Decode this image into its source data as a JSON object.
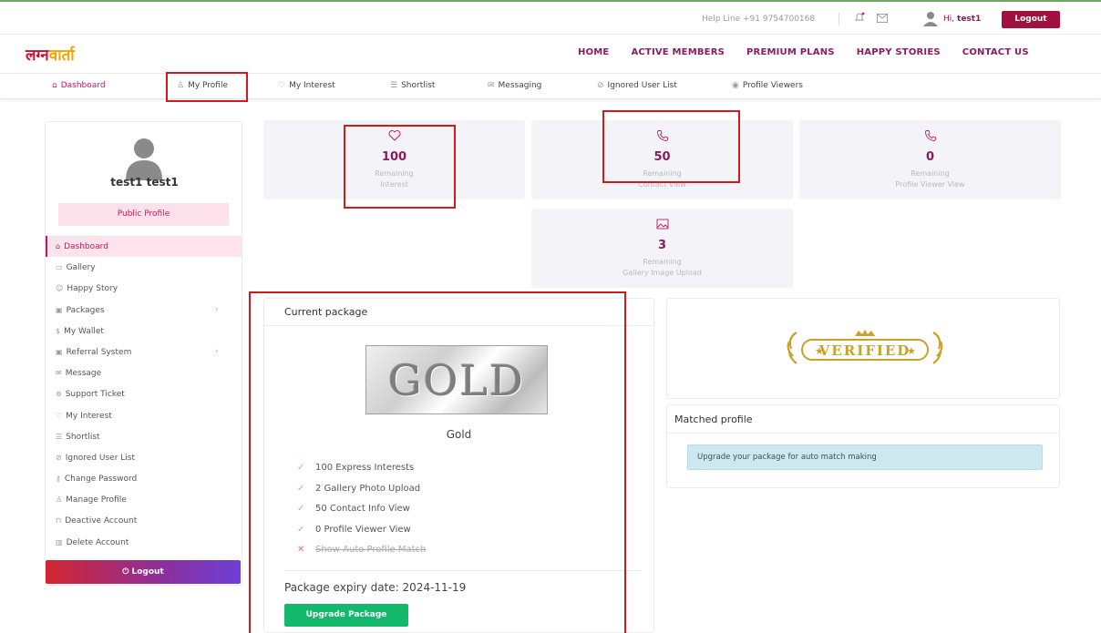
{
  "topbar": {
    "helpline": "Help Line +91 9754700168",
    "greeting_prefix": "Hi,",
    "username": "test1",
    "logout_label": "Logout"
  },
  "brand": {
    "part1": "लग्न",
    "part2": "वार्ता"
  },
  "mainnav": {
    "items": [
      "HOME",
      "ACTIVE MEMBERS",
      "PREMIUM PLANS",
      "HAPPY STORIES",
      "CONTACT US"
    ]
  },
  "subnav": {
    "items": [
      {
        "label": "Dashboard",
        "icon": "home-icon"
      },
      {
        "label": "My Profile",
        "icon": "user-icon"
      },
      {
        "label": "My Interest",
        "icon": "heart-icon"
      },
      {
        "label": "Shortlist",
        "icon": "list-icon"
      },
      {
        "label": "Messaging",
        "icon": "mail-icon"
      },
      {
        "label": "Ignored User List",
        "icon": "block-icon"
      },
      {
        "label": "Profile Viewers",
        "icon": "eye-icon"
      }
    ]
  },
  "sidebar": {
    "name": "test1 test1",
    "public_profile_label": "Public Profile",
    "menu": [
      {
        "label": "Dashboard",
        "icon": "home-icon"
      },
      {
        "label": "Gallery",
        "icon": "image-icon"
      },
      {
        "label": "Happy Story",
        "icon": "happy-icon"
      },
      {
        "label": "Packages",
        "icon": "package-icon"
      },
      {
        "label": "My Wallet",
        "icon": "dollar-icon"
      },
      {
        "label": "Referral System",
        "icon": "referral-icon"
      },
      {
        "label": "Message",
        "icon": "mail-icon"
      },
      {
        "label": "Support Ticket",
        "icon": "support-icon"
      },
      {
        "label": "My Interest",
        "icon": "heart-icon"
      },
      {
        "label": "Shortlist",
        "icon": "list-icon"
      },
      {
        "label": "Ignored User List",
        "icon": "block-icon"
      },
      {
        "label": "Change Password",
        "icon": "key-icon"
      },
      {
        "label": "Manage Profile",
        "icon": "user-icon"
      },
      {
        "label": "Deactive Account",
        "icon": "lock-icon"
      },
      {
        "label": "Delete Account",
        "icon": "trash-icon"
      }
    ],
    "logout_label": "Logout"
  },
  "stats": [
    {
      "value": "100",
      "line1": "Remaining",
      "line2": "Interest",
      "icon": "heart-icon"
    },
    {
      "value": "50",
      "line1": "Remaining",
      "line2": "Contact View",
      "icon": "phone-icon"
    },
    {
      "value": "0",
      "line1": "Remaining",
      "line2": "Profile Viewer View",
      "icon": "phone-icon"
    },
    {
      "value": "3",
      "line1": "Remaining",
      "line2": "Gallery Image Upload",
      "icon": "image-icon"
    }
  ],
  "package": {
    "header": "Current package",
    "badge_text": "GOLD",
    "name": "Gold",
    "features": [
      {
        "label": "100 Express Interests",
        "enabled": true
      },
      {
        "label": "2 Gallery Photo Upload",
        "enabled": true
      },
      {
        "label": "50 Contact Info View",
        "enabled": true
      },
      {
        "label": "0 Profile Viewer View",
        "enabled": true
      },
      {
        "label": "Show Auto Profile Match",
        "enabled": false
      }
    ],
    "expiry": "Package expiry date: 2024-11-19",
    "upgrade_label": "Upgrade Package"
  },
  "verified": {
    "badge_text": "VERIFIED"
  },
  "matched": {
    "header": "Matched profile",
    "message": "Upgrade your package for auto match making"
  },
  "colors": {
    "brand": "#8b1b5f",
    "accent_pink": "#c2185b",
    "logout_red": "#a1113f",
    "upgrade_green": "#14b86a",
    "highlight_box": "#d11a1a"
  }
}
